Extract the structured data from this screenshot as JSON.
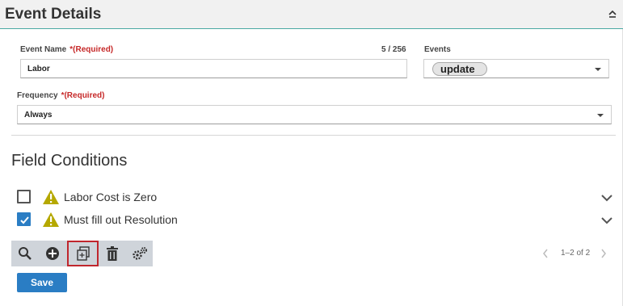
{
  "header": {
    "title": "Event Details",
    "collapse_icon": "chevron-up-icon"
  },
  "event_name": {
    "label": "Event Name",
    "required": "*(Required)",
    "value": "Labor",
    "counter": "5 / 256"
  },
  "events": {
    "label": "Events",
    "selected_chip": "update"
  },
  "frequency": {
    "label": "Frequency",
    "required": "*(Required)",
    "value": "Always"
  },
  "field_conditions": {
    "title": "Field Conditions",
    "items": [
      {
        "label": "Labor Cost is Zero",
        "checked": false,
        "icon": "warning-icon"
      },
      {
        "label": "Must fill out Resolution",
        "checked": true,
        "icon": "warning-icon"
      }
    ]
  },
  "toolbar": {
    "buttons": [
      "search-icon",
      "add-icon",
      "copy-icon",
      "delete-icon",
      "settings-icon"
    ],
    "active": "copy-icon"
  },
  "pagination": {
    "range": "1–2 of 2"
  },
  "actions": {
    "save_label": "Save"
  },
  "colors": {
    "accent": "#2a7dc4",
    "required": "#c62828",
    "warning": "#b5a800",
    "header_line": "#4aa9a2",
    "active_outline": "#c0262d"
  }
}
